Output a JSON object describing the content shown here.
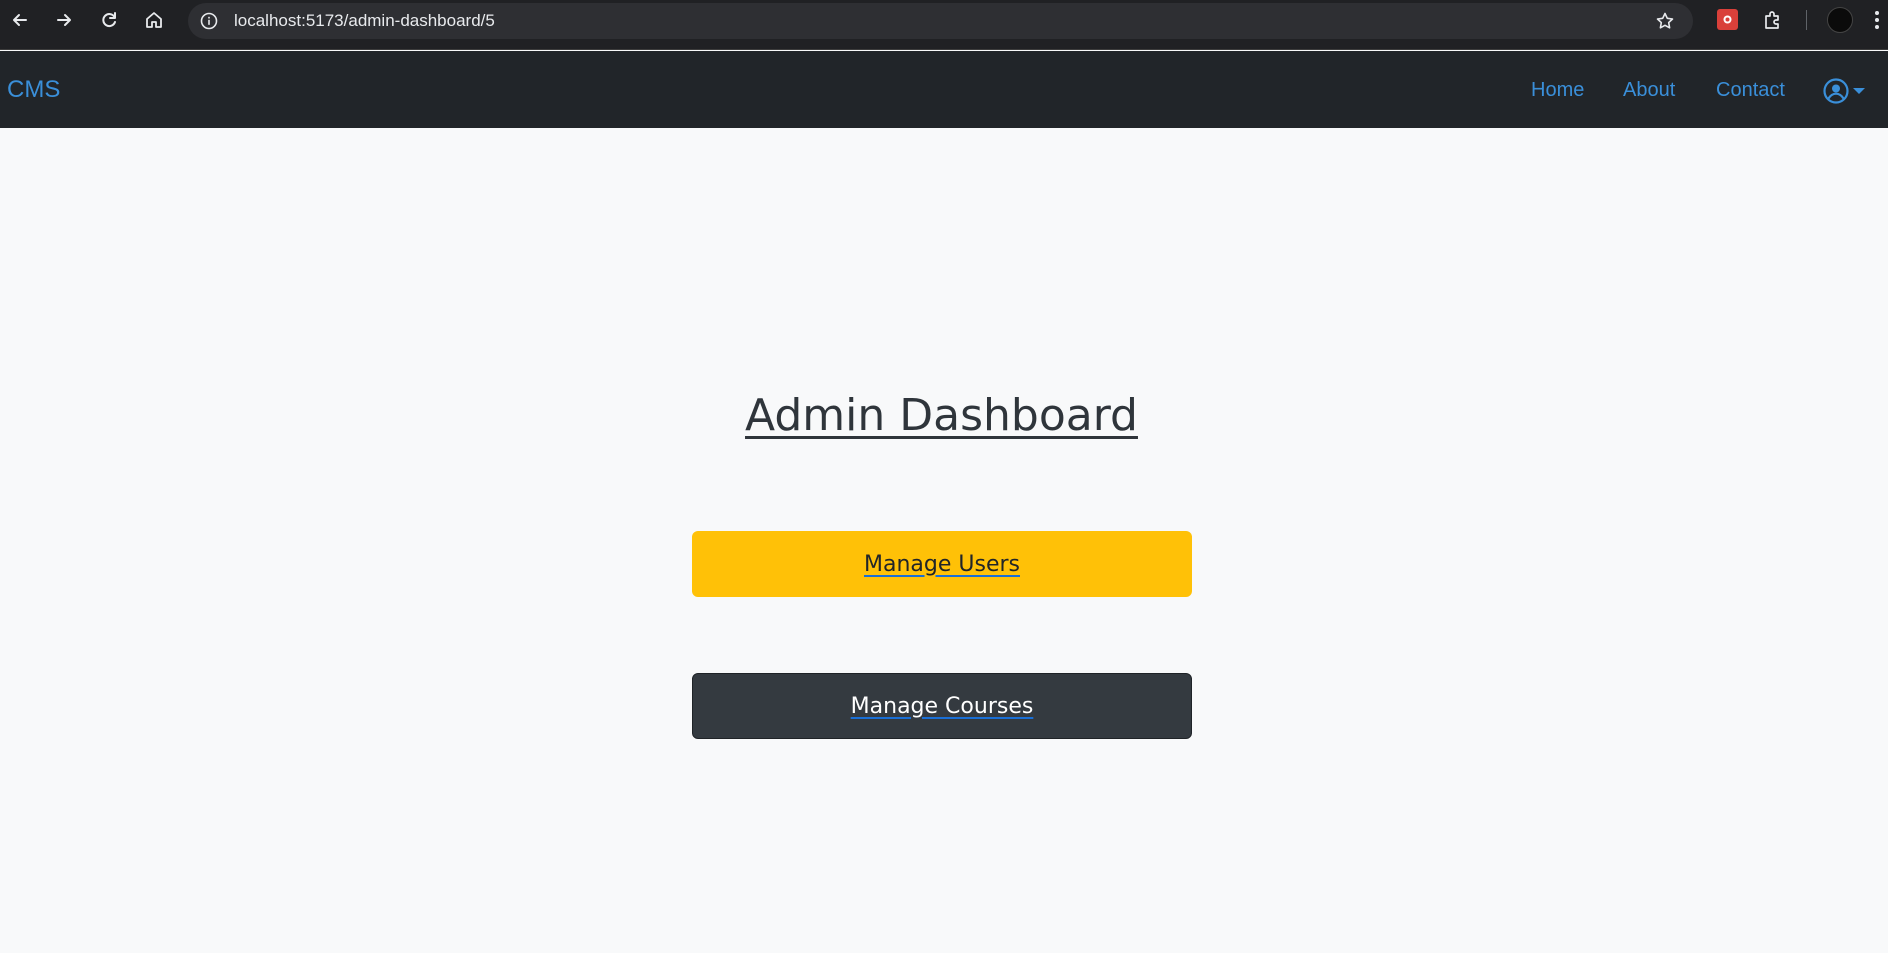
{
  "browser": {
    "url": "localhost:5173/admin-dashboard/5"
  },
  "navbar": {
    "brand": "CMS",
    "links": [
      "Home",
      "About",
      "Contact"
    ]
  },
  "main": {
    "title": "Admin Dashboard",
    "buttons": {
      "manage_users": "Manage Users",
      "manage_courses": "Manage Courses"
    }
  },
  "colors": {
    "accent": "#3a8fd9",
    "navbar_bg": "#212529",
    "warning": "#ffc107",
    "dark": "#343a40"
  }
}
